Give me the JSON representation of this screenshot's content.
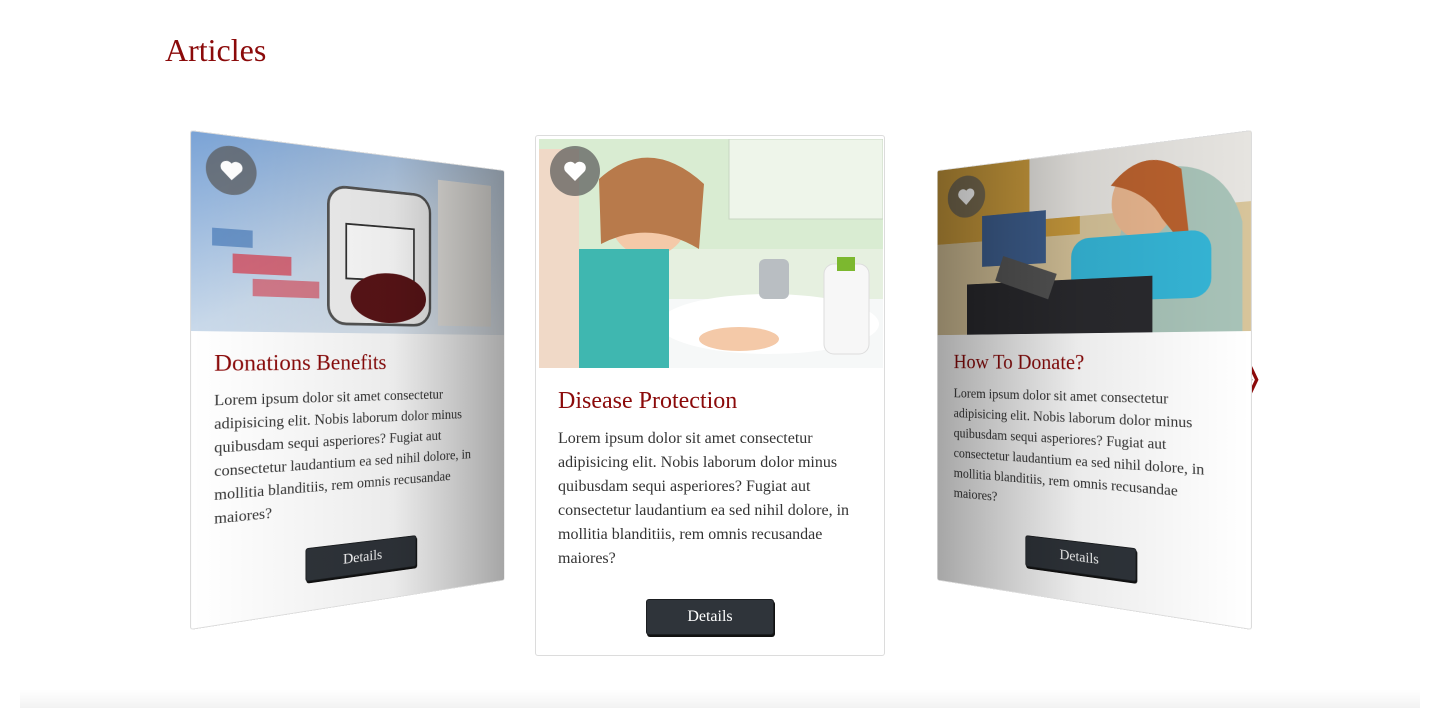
{
  "section": {
    "title": "Articles"
  },
  "nav": {
    "prev_glyph": "《",
    "next_glyph": "》"
  },
  "cards": [
    {
      "title": "Donations Benefits",
      "text": "Lorem ipsum dolor sit amet consectetur adipisicing elit. Nobis laborum dolor minus quibusdam sequi asperiores? Fugiat aut consectetur laudantium ea sed nihil dolore, in mollitia blanditiis, rem omnis recusandae maiores?",
      "button": "Details",
      "image_subject": "blood bag"
    },
    {
      "title": "Disease Protection",
      "text": "Lorem ipsum dolor sit amet consectetur adipisicing elit. Nobis laborum dolor minus quibusdam sequi asperiores? Fugiat aut consectetur laudantium ea sed nihil dolore, in mollitia blanditiis, rem omnis recusandae maiores?",
      "button": "Details",
      "image_subject": "child washing hands"
    },
    {
      "title": "How To Donate?",
      "text": "Lorem ipsum dolor sit amet consectetur adipisicing elit. Nobis laborum dolor minus quibusdam sequi asperiores? Fugiat aut consectetur laudantium ea sed nihil dolore, in mollitia blanditiis, rem omnis recusandae maiores?",
      "button": "Details",
      "image_subject": "donor in chair"
    }
  ],
  "icons": {
    "favorite": "heart-icon",
    "prev": "double-chevron-left-icon",
    "next": "double-chevron-right-icon"
  },
  "colors": {
    "accent": "#8b0a0a",
    "button_bg": "#2f343a",
    "fav_bg": "#5a5a5a"
  }
}
